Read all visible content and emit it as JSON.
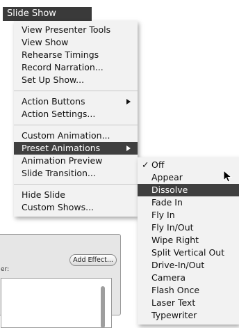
{
  "menu_title": "Slide Show",
  "menu_groups": [
    [
      {
        "label": "View Presenter Tools"
      },
      {
        "label": "View Show"
      },
      {
        "label": "Rehearse Timings"
      },
      {
        "label": "Record Narration..."
      },
      {
        "label": "Set Up Show..."
      }
    ],
    [
      {
        "label": "Action Buttons",
        "submenu": true
      },
      {
        "label": "Action Settings..."
      }
    ],
    [
      {
        "label": "Custom Animation..."
      },
      {
        "label": "Preset Animations",
        "submenu": true,
        "selected": true
      },
      {
        "label": "Animation Preview"
      },
      {
        "label": "Slide Transition..."
      }
    ],
    [
      {
        "label": "Hide Slide"
      },
      {
        "label": "Custom Shows..."
      }
    ]
  ],
  "submenu": {
    "items": [
      {
        "label": "Off",
        "checked": true
      },
      {
        "label": "Appear"
      },
      {
        "label": "Dissolve",
        "highlighted": true
      },
      {
        "label": "Fade In"
      },
      {
        "label": "Fly In"
      },
      {
        "label": "Fly In/Out"
      },
      {
        "label": "Wipe Right"
      },
      {
        "label": "Split Vertical Out"
      },
      {
        "label": "Drive-In/Out"
      },
      {
        "label": "Camera"
      },
      {
        "label": "Flash Once"
      },
      {
        "label": "Laser Text"
      },
      {
        "label": "Typewriter"
      }
    ],
    "check_glyph": "✓"
  },
  "background_window": {
    "add_effect_label": "Add Effect...",
    "field_label": "er:"
  },
  "colors": {
    "menu_bg": "#f2f2f2",
    "highlight": "#3f3f3f",
    "title_bg": "#3a3a3a"
  }
}
